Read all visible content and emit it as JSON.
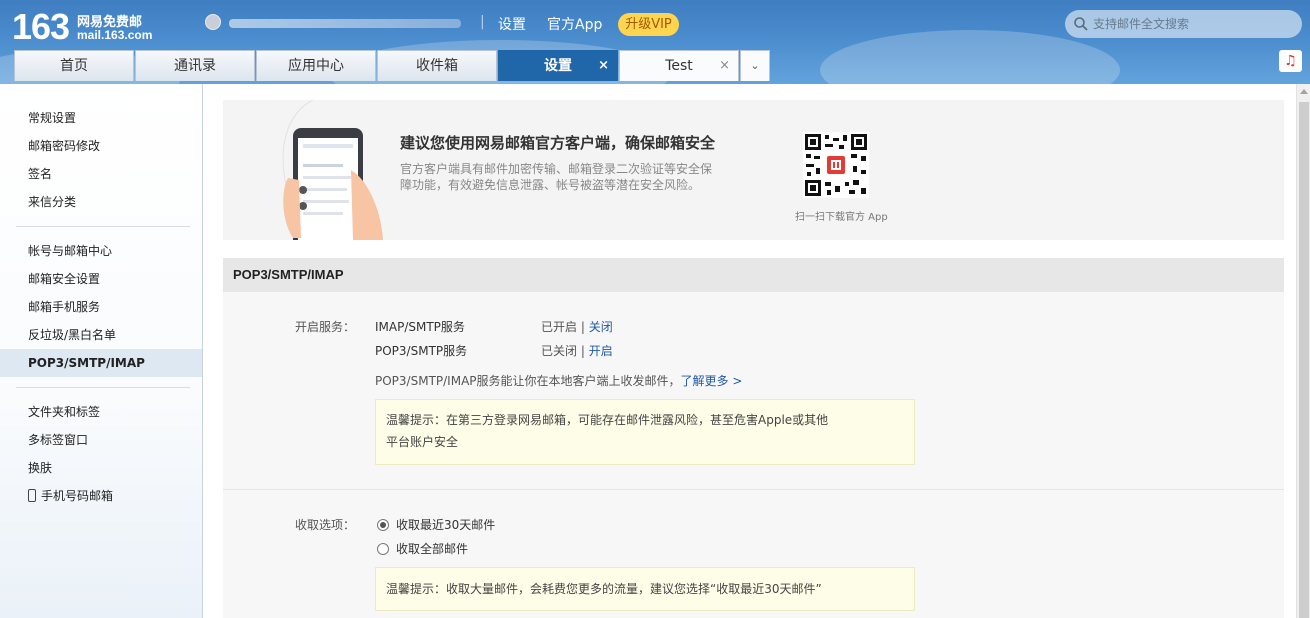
{
  "header": {
    "logo_number": "163",
    "logo_name": "网易免费邮",
    "logo_domain": "mail.163.com",
    "separator": "|",
    "links": {
      "settings": "设置",
      "app": "官方App"
    },
    "vip_label": "升级VIP",
    "search_placeholder": "支持邮件全文搜索"
  },
  "tabs": [
    {
      "label": "首页"
    },
    {
      "label": "通讯录"
    },
    {
      "label": "应用中心"
    },
    {
      "label": "收件箱"
    },
    {
      "label": "设置",
      "close": "×"
    },
    {
      "label": "Test",
      "close": "×"
    }
  ],
  "tab_more": "⌄",
  "sidebar": {
    "group1": [
      "常规设置",
      "邮箱密码修改",
      "签名",
      "来信分类"
    ],
    "group2": [
      "帐号与邮箱中心",
      "邮箱安全设置",
      "邮箱手机服务",
      "反垃圾/黑白名单",
      "POP3/SMTP/IMAP"
    ],
    "group3": [
      "文件夹和标签",
      "多标签窗口",
      "换肤",
      "手机号码邮箱"
    ]
  },
  "promo": {
    "title": "建议您使用网易邮箱官方客户端，确保邮箱安全",
    "desc": "官方客户端具有邮件加密传输、邮箱登录二次验证等安全保障功能，有效避免信息泄露、帐号被盗等潜在安全风险。",
    "qr_caption": "扫一扫下载官方 App"
  },
  "section": {
    "title": "POP3/SMTP/IMAP",
    "service_label": "开启服务：",
    "services": [
      {
        "name": "IMAP/SMTP服务",
        "status": "已开启",
        "sep": "|",
        "action": "关闭"
      },
      {
        "name": "POP3/SMTP服务",
        "status": "已关闭",
        "sep": "|",
        "action": "开启"
      }
    ],
    "info_text": "POP3/SMTP/IMAP服务能让你在本地客户端上收发邮件，",
    "info_link": "了解更多 >",
    "tip1_line1": "温馨提示：在第三方登录网易邮箱，可能存在邮件泄露风险，甚至危害Apple或其他",
    "tip1_line2": "平台账户安全",
    "receive_label": "收取选项：",
    "receive_options": [
      "收取最近30天邮件",
      "收取全部邮件"
    ],
    "receive_selected": 0,
    "tip2": "温馨提示：收取大量邮件，会耗费您更多的流量，建议您选择“收取最近30天邮件”"
  },
  "colors": {
    "header_blue": "#4a8ccd",
    "active_tab": "#1f67a9",
    "vip": "#ffd44f",
    "link": "#1f5aa6"
  }
}
